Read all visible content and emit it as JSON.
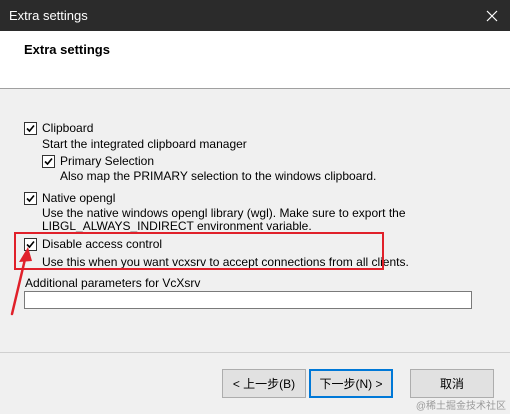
{
  "window": {
    "title": "Extra settings",
    "close_glyph": "✕"
  },
  "header": {
    "heading": "Extra settings"
  },
  "options": {
    "clipboard": {
      "label": "Clipboard",
      "checked": true,
      "description": "Start the integrated clipboard manager",
      "primary_selection": {
        "label": "Primary Selection",
        "checked": true,
        "description": "Also map the PRIMARY selection to the windows clipboard."
      }
    },
    "native_opengl": {
      "label": "Native opengl",
      "checked": true,
      "description_line1": "Use the native windows opengl library (wgl). Make sure to export the",
      "description_line2": "LIBGL_ALWAYS_INDIRECT environment variable."
    },
    "disable_access_control": {
      "label": "Disable access control",
      "checked": true,
      "description": "Use this when you want vcxsrv to accept connections from all clients."
    }
  },
  "parameters": {
    "label": "Additional parameters for VcXsrv",
    "value": ""
  },
  "buttons": {
    "back": "< 上一步(B)",
    "next": "下一步(N) >",
    "cancel": "取消"
  },
  "annotation": {
    "color": "#e0202a"
  },
  "watermark": "@稀土掘金技术社区"
}
